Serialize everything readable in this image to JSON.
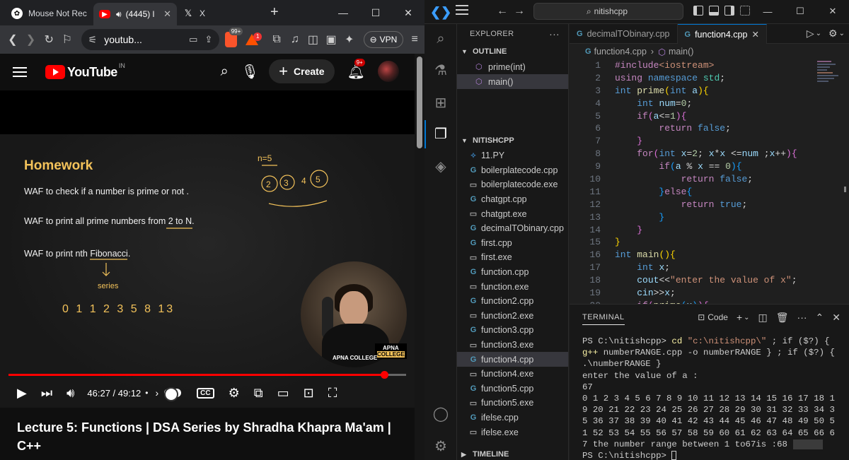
{
  "browser": {
    "tabs": [
      {
        "label": "Mouse Not Rec",
        "icon": "chatgpt-icon"
      },
      {
        "label": "(4445) l",
        "icon": "youtube-icon",
        "audio": true
      },
      {
        "label": "X",
        "icon": "x-icon"
      }
    ],
    "url": "youtub...",
    "vpn_label": "VPN",
    "brave_badge": "99+",
    "rewards_badge": "1"
  },
  "youtube": {
    "logo_text": "YouTube",
    "region": "IN",
    "create_label": "Create",
    "notif_count": "9+",
    "time": "46:27 / 49:12",
    "progress": 0.945,
    "title": "Lecture 5: Functions | DSA Series by Shradha Khapra Ma'am | C++",
    "video": {
      "heading": "Homework",
      "lines": [
        "WAF to check if a number is prime or not .",
        "WAF to print all prime numbers from 2 to N.",
        "WAF to print nth Fibonacci."
      ],
      "annotations": [
        "n=5",
        "2",
        "3",
        "4",
        "5",
        "series",
        "0 1 1 2 3 5 8 13"
      ],
      "logo_top": "APNA",
      "logo_bottom": "COLLEGE",
      "watermark": "APNA COLLEGE"
    }
  },
  "vscode": {
    "search": "nitishcpp",
    "explorer_title": "EXPLORER",
    "outline_title": "OUTLINE",
    "outline": [
      {
        "label": "prime(int)",
        "selected": false
      },
      {
        "label": "main()",
        "selected": true
      }
    ],
    "folder_title": "NITISHCPP",
    "files": [
      {
        "name": "11.PY",
        "type": "py"
      },
      {
        "name": "boilerplatecode.cpp",
        "type": "cpp"
      },
      {
        "name": "boilerplatecode.exe",
        "type": "exe"
      },
      {
        "name": "chatgpt.cpp",
        "type": "cpp"
      },
      {
        "name": "chatgpt.exe",
        "type": "exe"
      },
      {
        "name": "decimalTObinary.cpp",
        "type": "cpp"
      },
      {
        "name": "first.cpp",
        "type": "cpp"
      },
      {
        "name": "first.exe",
        "type": "exe"
      },
      {
        "name": "function.cpp",
        "type": "cpp"
      },
      {
        "name": "function.exe",
        "type": "exe"
      },
      {
        "name": "function2.cpp",
        "type": "cpp"
      },
      {
        "name": "function2.exe",
        "type": "exe"
      },
      {
        "name": "function3.cpp",
        "type": "cpp"
      },
      {
        "name": "function3.exe",
        "type": "exe"
      },
      {
        "name": "function4.cpp",
        "type": "cpp",
        "selected": true
      },
      {
        "name": "function4.exe",
        "type": "exe"
      },
      {
        "name": "function5.cpp",
        "type": "cpp"
      },
      {
        "name": "function5.exe",
        "type": "exe"
      },
      {
        "name": "ifelse.cpp",
        "type": "cpp"
      },
      {
        "name": "ifelse.exe",
        "type": "exe"
      }
    ],
    "timeline_title": "TIMELINE",
    "editor_tabs": [
      {
        "label": "decimalTObinary.cpp",
        "active": false
      },
      {
        "label": "function4.cpp",
        "active": true
      }
    ],
    "breadcrumb": [
      "function4.cpp",
      "main()"
    ],
    "line_numbers": [
      "1",
      "2",
      "3",
      "4",
      "5",
      "6",
      "7",
      "8",
      "9",
      "10",
      "11",
      "12",
      "13",
      "14",
      "15",
      "16",
      "17",
      "18",
      "19",
      "20"
    ],
    "terminal_title": "TERMINAL",
    "terminal_profile": "Code",
    "terminal": {
      "line1_prompt": "PS C:\\nitishcpp>",
      "line1_cmd": "cd",
      "line1_path": "\"c:\\nitishcpp\\\"",
      "line1_rest1": "; if ($?) {",
      "line1_gpp": "g++",
      "line1_rest2": "numberRANGE.cpp -o numberRANGE } ; if ($?) { .\\numberRANGE }",
      "output1": "enter the value of a :",
      "output2": "67",
      "output3": "0 1 2 3 4 5 6 7 8 9 10 11 12 13 14 15 16 17 18 19 20 21 22 23 24 25 26 27 28 29 30 31 32 33 34 35 36 37 38 39 40 41 42 43 44 45 46 47 48 49 50 51 52 53 54 55 56 57 58 59 60 61 62 63 64 65 66 67 the number range between 1 to67is :68",
      "prompt2": "PS C:\\nitishcpp>"
    }
  }
}
